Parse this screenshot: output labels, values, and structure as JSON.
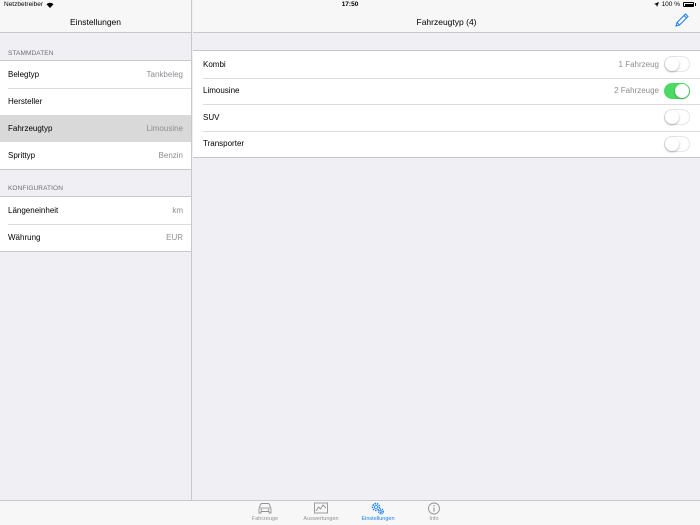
{
  "status_bar": {
    "carrier": "Netzbetreiber",
    "time": "17:50",
    "battery": "100 %"
  },
  "master": {
    "title": "Einstellungen",
    "sections": [
      {
        "header": "STAMMDATEN",
        "rows": [
          {
            "label": "Belegtyp",
            "value": "Tankbeleg"
          },
          {
            "label": "Hersteller",
            "value": ""
          },
          {
            "label": "Fahrzeugtyp",
            "value": "Limousine",
            "selected": true
          },
          {
            "label": "Sprittyp",
            "value": "Benzin"
          }
        ]
      },
      {
        "header": "KONFIGURATION",
        "rows": [
          {
            "label": "Längeneinheit",
            "value": "km"
          },
          {
            "label": "Währung",
            "value": "EUR"
          }
        ]
      }
    ]
  },
  "detail": {
    "title": "Fahrzeugtyp (4)",
    "edit_icon": "pencil-icon",
    "rows": [
      {
        "label": "Kombi",
        "count": "1 Fahrzeug",
        "enabled": false
      },
      {
        "label": "Limousine",
        "count": "2 Fahrzeuge",
        "enabled": true
      },
      {
        "label": "SUV",
        "count": "",
        "enabled": false
      },
      {
        "label": "Transporter",
        "count": "",
        "enabled": false
      }
    ]
  },
  "tabbar": {
    "tabs": [
      {
        "label": "Fahrzeuge",
        "icon": "car-icon",
        "active": false
      },
      {
        "label": "Auswertungen",
        "icon": "chart-icon",
        "active": false
      },
      {
        "label": "Einstellungen",
        "icon": "gears-icon",
        "active": true
      },
      {
        "label": "Info",
        "icon": "info-icon",
        "active": false
      }
    ]
  },
  "colors": {
    "accent": "#1b7ff4",
    "toggle_on": "#4cd964",
    "selected_row": "#d9d9d9",
    "background": "#efeff4"
  }
}
